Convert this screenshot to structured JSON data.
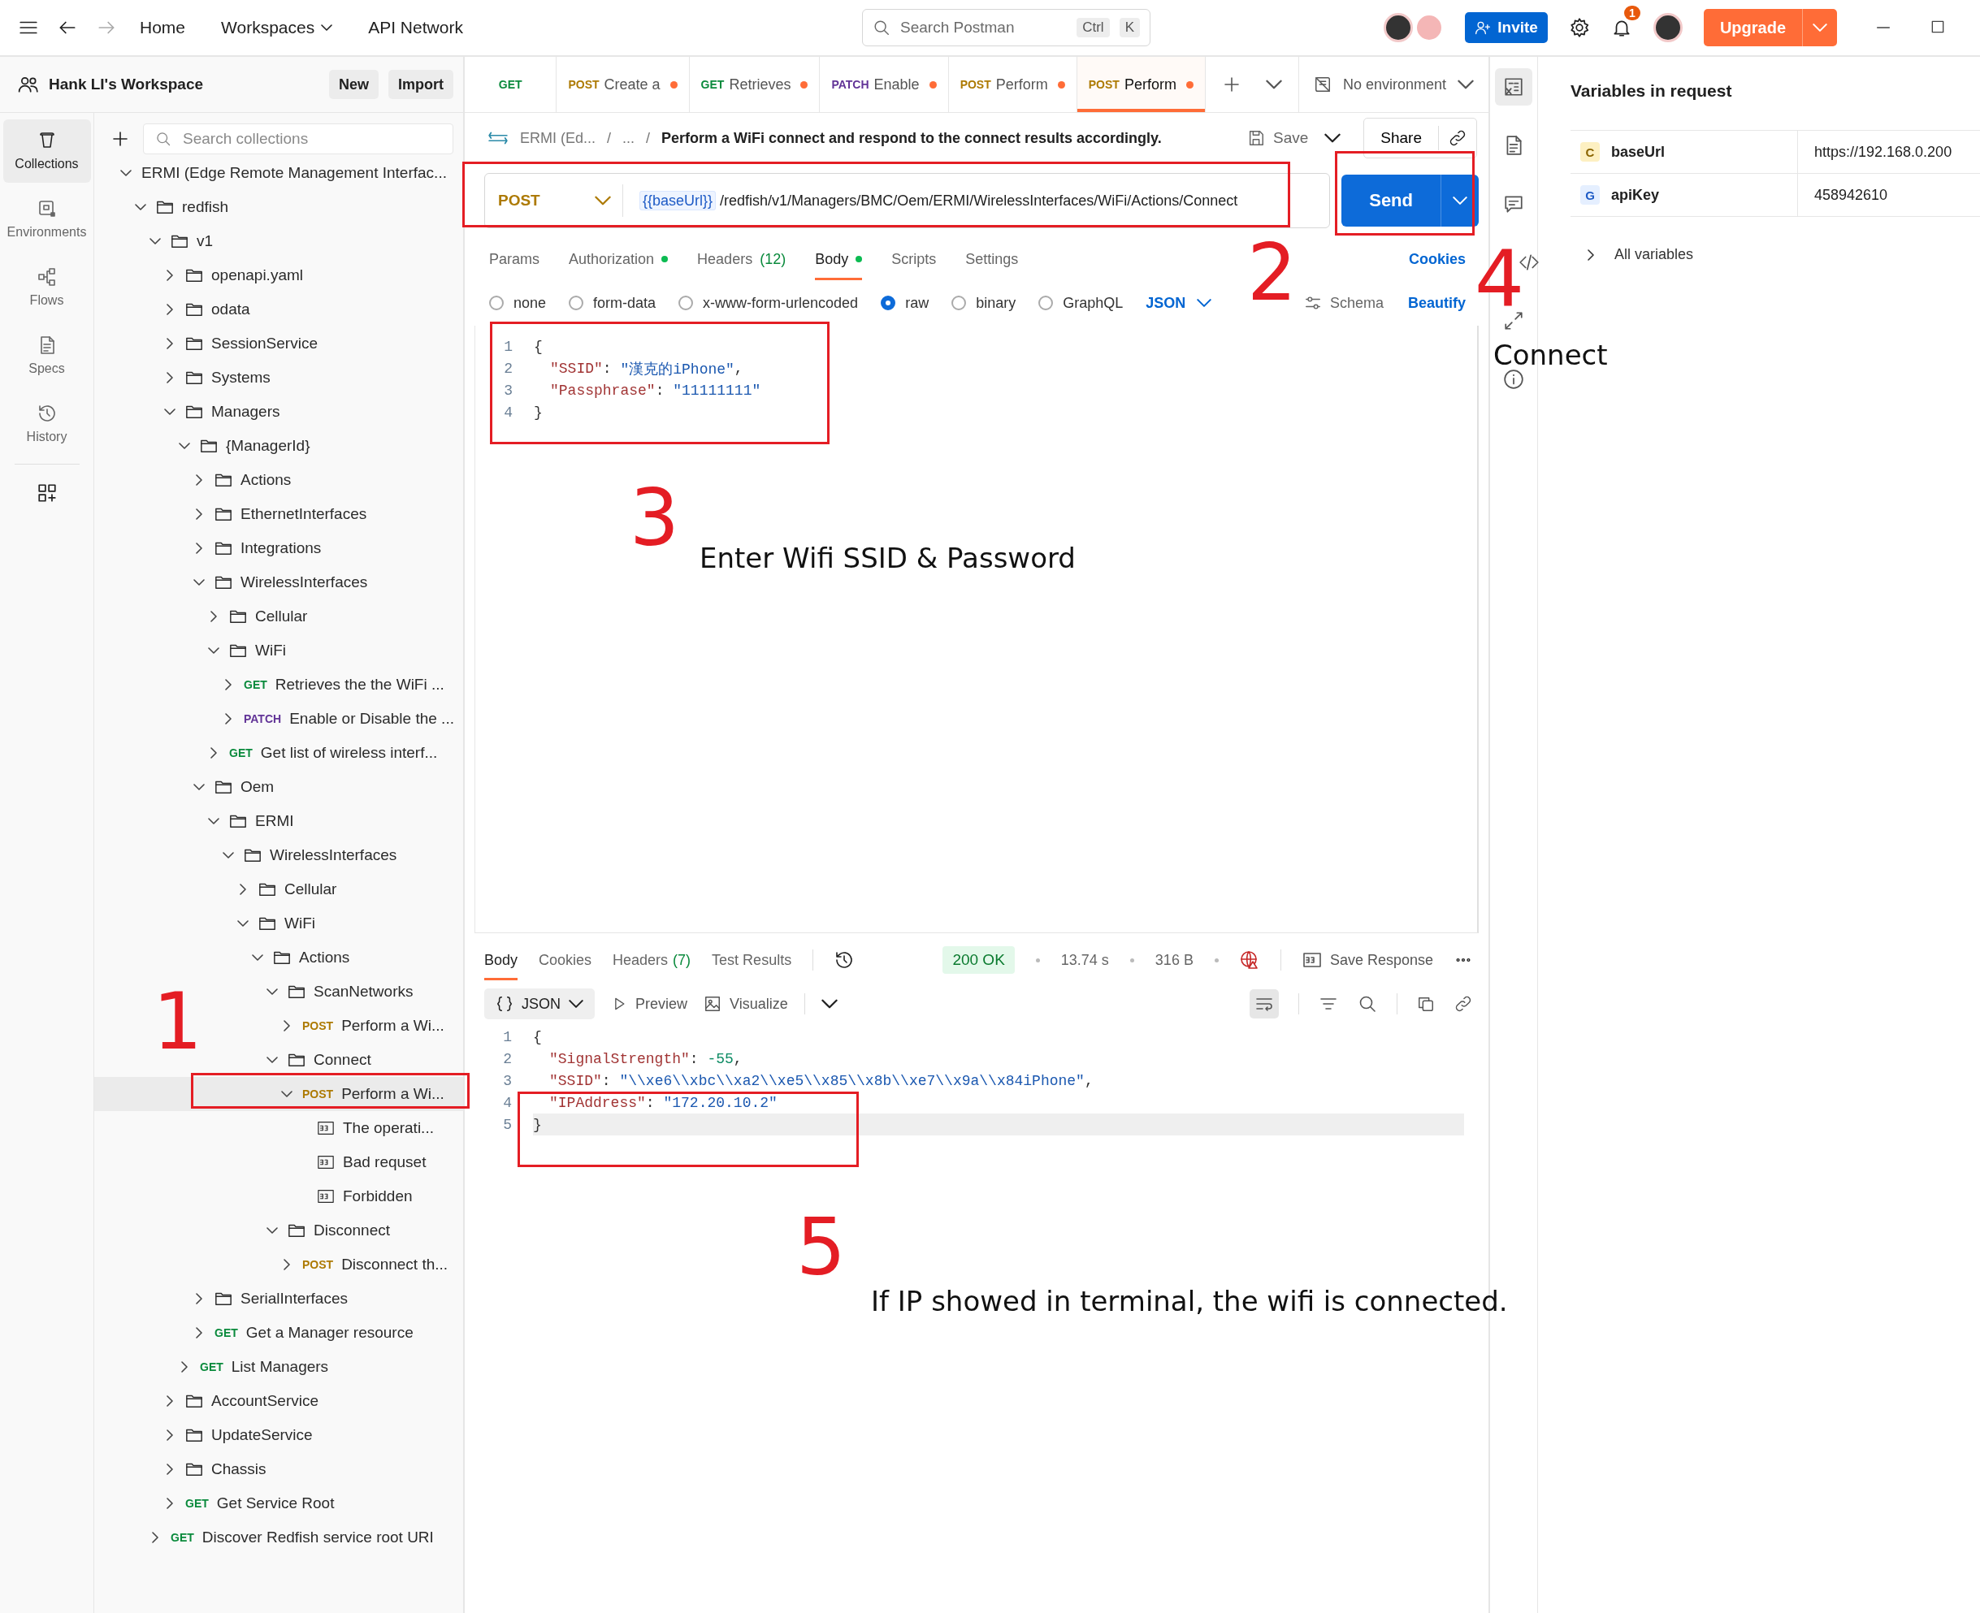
{
  "top_bar": {
    "nav": [
      {
        "label": "Home",
        "dropdown": false
      },
      {
        "label": "Workspaces",
        "dropdown": true
      },
      {
        "label": "API Network",
        "dropdown": false
      }
    ],
    "search": {
      "placeholder": "Search Postman",
      "keys": [
        "Ctrl",
        "K"
      ]
    },
    "invite": "Invite",
    "notifications": "1",
    "upgrade": "Upgrade"
  },
  "workspace": {
    "name": "Hank LI's Workspace",
    "buttons": [
      "New",
      "Import"
    ]
  },
  "rail": [
    {
      "label": "Collections",
      "selected": true
    },
    {
      "label": "Environments",
      "selected": false
    },
    {
      "label": "Flows",
      "selected": false
    },
    {
      "label": "Specs",
      "selected": false
    },
    {
      "label": "History",
      "selected": false
    }
  ],
  "collections_search": {
    "placeholder": "Search collections"
  },
  "tree": {
    "children": [
      {
        "label": "ERMI (Edge Remote Management Interfac...",
        "expanded": true,
        "selected": false,
        "children": [
          {
            "kind": "folder",
            "label": "redfish",
            "expanded": true,
            "selected": false,
            "children": [
              {
                "kind": "folder",
                "label": "v1",
                "expanded": true,
                "selected": false,
                "children": [
                  {
                    "kind": "folder",
                    "label": "openapi.yaml",
                    "expanded": false,
                    "selected": false
                  },
                  {
                    "kind": "folder",
                    "label": "odata",
                    "expanded": false,
                    "selected": false
                  },
                  {
                    "kind": "folder",
                    "label": "SessionService",
                    "expanded": false,
                    "selected": false
                  },
                  {
                    "kind": "folder",
                    "label": "Systems",
                    "expanded": false,
                    "selected": false
                  },
                  {
                    "kind": "folder",
                    "label": "Managers",
                    "expanded": true,
                    "selected": false,
                    "children": [
                      {
                        "kind": "folder",
                        "label": "{ManagerId}",
                        "expanded": true,
                        "selected": false,
                        "children": [
                          {
                            "kind": "folder",
                            "label": "Actions",
                            "expanded": false,
                            "selected": false
                          },
                          {
                            "kind": "folder",
                            "label": "EthernetInterfaces",
                            "expanded": false,
                            "selected": false
                          },
                          {
                            "kind": "folder",
                            "label": "Integrations",
                            "expanded": false,
                            "selected": false
                          },
                          {
                            "kind": "folder",
                            "label": "WirelessInterfaces",
                            "expanded": true,
                            "selected": false,
                            "children": [
                              {
                                "kind": "folder",
                                "label": "Cellular",
                                "expanded": false,
                                "selected": false
                              },
                              {
                                "kind": "folder",
                                "label": "WiFi",
                                "expanded": true,
                                "selected": false,
                                "children": [
                                  {
                                    "kind": "request",
                                    "method": "GET",
                                    "color": "#0a8a3c",
                                    "label": "Retrieves the the WiFi ...",
                                    "expanded": false,
                                    "selected": false
                                  },
                                  {
                                    "kind": "request",
                                    "method": "PATCH",
                                    "color": "#623497",
                                    "label": "Enable or Disable the ...",
                                    "expanded": false,
                                    "selected": false
                                  }
                                ]
                              },
                              {
                                "kind": "request",
                                "method": "GET",
                                "color": "#0a8a3c",
                                "label": "Get list of wireless interf...",
                                "expanded": false,
                                "selected": false
                              }
                            ]
                          },
                          {
                            "kind": "folder",
                            "label": "Oem",
                            "expanded": true,
                            "selected": false,
                            "children": [
                              {
                                "kind": "folder",
                                "label": "ERMI",
                                "expanded": true,
                                "selected": false,
                                "children": [
                                  {
                                    "kind": "folder",
                                    "label": "WirelessInterfaces",
                                    "expanded": true,
                                    "selected": false,
                                    "children": [
                                      {
                                        "kind": "folder",
                                        "label": "Cellular",
                                        "expanded": false,
                                        "selected": false
                                      },
                                      {
                                        "kind": "folder",
                                        "label": "WiFi",
                                        "expanded": true,
                                        "selected": false,
                                        "children": [
                                          {
                                            "kind": "folder",
                                            "label": "Actions",
                                            "expanded": true,
                                            "selected": false,
                                            "children": [
                                              {
                                                "kind": "folder",
                                                "label": "ScanNetworks",
                                                "expanded": true,
                                                "selected": false,
                                                "children": [
                                                  {
                                                    "kind": "request",
                                                    "method": "POST",
                                                    "color": "#ad7a03",
                                                    "label": "Perform a Wi...",
                                                    "expanded": false,
                                                    "selected": false
                                                  }
                                                ]
                                              },
                                              {
                                                "kind": "folder",
                                                "label": "Connect",
                                                "expanded": true,
                                                "selected": false,
                                                "children": [
                                                  {
                                                    "kind": "request",
                                                    "method": "POST",
                                                    "color": "#ad7a03",
                                                    "label": "Perform a Wi...",
                                                    "expanded": true,
                                                    "selected": true,
                                                    "children": [
                                                      {
                                                        "kind": "example",
                                                        "label": "The operati...",
                                                        "selected": false
                                                      },
                                                      {
                                                        "kind": "example",
                                                        "label": "Bad requset",
                                                        "selected": false
                                                      },
                                                      {
                                                        "kind": "example",
                                                        "label": "Forbidden",
                                                        "selected": false
                                                      }
                                                    ]
                                                  }
                                                ]
                                              },
                                              {
                                                "kind": "folder",
                                                "label": "Disconnect",
                                                "expanded": true,
                                                "selected": false,
                                                "children": [
                                                  {
                                                    "kind": "request",
                                                    "method": "POST",
                                                    "color": "#ad7a03",
                                                    "label": "Disconnect th...",
                                                    "expanded": false,
                                                    "selected": false
                                                  }
                                                ]
                                              }
                                            ]
                                          }
                                        ]
                                      }
                                    ]
                                  }
                                ]
                              }
                            ]
                          },
                          {
                            "kind": "folder",
                            "label": "SerialInterfaces",
                            "expanded": false,
                            "selected": false
                          },
                          {
                            "kind": "request",
                            "method": "GET",
                            "color": "#0a8a3c",
                            "label": "Get a Manager resource",
                            "expanded": false,
                            "selected": false
                          }
                        ]
                      },
                      {
                        "kind": "request",
                        "method": "GET",
                        "color": "#0a8a3c",
                        "label": "List Managers",
                        "expanded": false,
                        "selected": false
                      }
                    ]
                  },
                  {
                    "kind": "folder",
                    "label": "AccountService",
                    "expanded": false,
                    "selected": false
                  },
                  {
                    "kind": "folder",
                    "label": "UpdateService",
                    "expanded": false,
                    "selected": false
                  },
                  {
                    "kind": "folder",
                    "label": "Chassis",
                    "expanded": false,
                    "selected": false
                  },
                  {
                    "kind": "request",
                    "method": "GET",
                    "color": "#0a8a3c",
                    "label": "Get Service Root",
                    "expanded": false,
                    "selected": false
                  }
                ]
              },
              {
                "kind": "request",
                "method": "GET",
                "color": "#0a8a3c",
                "label": "Discover Redfish service root URI",
                "expanded": false,
                "selected": false
              }
            ]
          }
        ]
      }
    ]
  },
  "tabs": [
    {
      "method": "GET",
      "color": "#0a8a3c",
      "selected": false,
      "modified": false
    },
    {
      "method": "POST",
      "color": "#ad7a03",
      "label": "Create a",
      "selected": false,
      "modified": true
    },
    {
      "method": "GET",
      "color": "#0a8a3c",
      "label": "Retrieves",
      "selected": false,
      "modified": true
    },
    {
      "method": "PATCH",
      "color": "#623497",
      "label": "Enable",
      "selected": false,
      "modified": true
    },
    {
      "method": "POST",
      "color": "#ad7a03",
      "label": "Perform",
      "selected": false,
      "modified": true
    },
    {
      "method": "POST",
      "color": "#ad7a03",
      "label": "Perform",
      "selected": true,
      "modified": true
    }
  ],
  "environment": "No environment",
  "request": {
    "breadcrumb": [
      "ERMI (Ed...",
      "/",
      "...",
      "/"
    ],
    "title": "Perform a WiFi connect and respond to the connect results accordingly.",
    "save": "Save",
    "share": "Share",
    "method": "POST",
    "url_variable": "{{baseUrl}}",
    "url_path": "/redfish/v1/Managers/BMC/Oem/ERMI/WirelessInterfaces/WiFi/Actions/Connect",
    "send": "Send",
    "tabs": [
      {
        "label": "Params",
        "selected": false,
        "dot": false
      },
      {
        "label": "Authorization",
        "selected": false,
        "dot": true
      },
      {
        "label": "Headers",
        "count": "(12)",
        "selected": false,
        "dot": false
      },
      {
        "label": "Body",
        "selected": true,
        "dot": true
      },
      {
        "label": "Scripts",
        "selected": false,
        "dot": false
      },
      {
        "label": "Settings",
        "selected": false,
        "dot": false
      }
    ],
    "cookies": "Cookies",
    "body_types": [
      {
        "label": "none",
        "checked": false
      },
      {
        "label": "form-data",
        "checked": false
      },
      {
        "label": "x-www-form-urlencoded",
        "checked": false
      },
      {
        "label": "raw",
        "checked": true
      },
      {
        "label": "binary",
        "checked": false
      },
      {
        "label": "GraphQL",
        "checked": false
      }
    ],
    "format": "JSON",
    "schema": "Schema",
    "beautify": "Beautify",
    "body_lines": [
      {
        "number": "1",
        "indented": false,
        "tokens": [
          {
            "text": "{",
            "kind": "punct"
          }
        ]
      },
      {
        "number": "2",
        "indented": true,
        "tokens": [
          {
            "text": "\"SSID\"",
            "kind": "key"
          },
          {
            "text": ": ",
            "kind": "punct"
          },
          {
            "text": "\"漢克的iPhone\"",
            "kind": "string"
          },
          {
            "text": ",",
            "kind": "punct"
          }
        ]
      },
      {
        "number": "3",
        "indented": true,
        "tokens": [
          {
            "text": "\"Passphrase\"",
            "kind": "key"
          },
          {
            "text": ": ",
            "kind": "punct"
          },
          {
            "text": "\"11111111\"",
            "kind": "string"
          }
        ]
      },
      {
        "number": "4",
        "indented": false,
        "tokens": [
          {
            "text": "}",
            "kind": "punct"
          }
        ]
      }
    ]
  },
  "response": {
    "tabs": [
      {
        "label": "Body",
        "selected": true
      },
      {
        "label": "Cookies",
        "selected": false
      },
      {
        "label": "Headers",
        "count": "(7)",
        "selected": false
      },
      {
        "label": "Test Results",
        "selected": false
      }
    ],
    "status": "200 OK",
    "time": "13.74 s",
    "size": "316 B",
    "save": "Save Response",
    "format": "JSON",
    "preview": "Preview",
    "visualize": "Visualize",
    "lines": [
      {
        "number": "1",
        "indented": false,
        "current": false,
        "tokens": [
          {
            "text": "{",
            "kind": "punct"
          }
        ]
      },
      {
        "number": "2",
        "indented": true,
        "current": false,
        "tokens": [
          {
            "text": "\"SignalStrength\"",
            "kind": "key"
          },
          {
            "text": ": ",
            "kind": "punct"
          },
          {
            "text": "-55",
            "kind": "number"
          },
          {
            "text": ",",
            "kind": "punct"
          }
        ]
      },
      {
        "number": "3",
        "indented": true,
        "current": false,
        "tokens": [
          {
            "text": "\"SSID\"",
            "kind": "key"
          },
          {
            "text": ": ",
            "kind": "punct"
          },
          {
            "text": "\"\\\\xe6\\\\xbc\\\\xa2\\\\xe5\\\\x85\\\\x8b\\\\xe7\\\\x9a\\\\x84iPhone\"",
            "kind": "string"
          },
          {
            "text": ",",
            "kind": "punct"
          }
        ]
      },
      {
        "number": "4",
        "indented": true,
        "current": false,
        "tokens": [
          {
            "text": "\"IPAddress\"",
            "kind": "key"
          },
          {
            "text": ": ",
            "kind": "punct"
          },
          {
            "text": "\"172.20.10.2\"",
            "kind": "string"
          }
        ]
      },
      {
        "number": "5",
        "indented": false,
        "current": true,
        "tokens": [
          {
            "text": "}",
            "kind": "punct"
          }
        ]
      }
    ]
  },
  "variables": {
    "title": "Variables in request",
    "rows": [
      {
        "scope": "C",
        "color": "#fdf0c2",
        "name": "baseUrl",
        "value": "https://192.168.0.200"
      },
      {
        "scope": "G",
        "color": "#e5efff",
        "name": "apiKey",
        "value": "458942610"
      }
    ],
    "all": "All variables"
  },
  "annotations": [
    {
      "kind": "box"
    },
    {
      "kind": "box"
    },
    {
      "kind": "number",
      "text": "2"
    },
    {
      "kind": "number",
      "text": "4"
    },
    {
      "kind": "box"
    },
    {
      "kind": "note",
      "text": "Connect"
    },
    {
      "kind": "number",
      "text": "3"
    },
    {
      "kind": "note",
      "text": "Enter Wifi SSID & Password"
    },
    {
      "kind": "number",
      "text": "1"
    },
    {
      "kind": "box"
    },
    {
      "kind": "box"
    },
    {
      "kind": "number",
      "text": "5"
    },
    {
      "kind": "note",
      "text": "If IP showed in terminal, the wifi is connected."
    }
  ]
}
